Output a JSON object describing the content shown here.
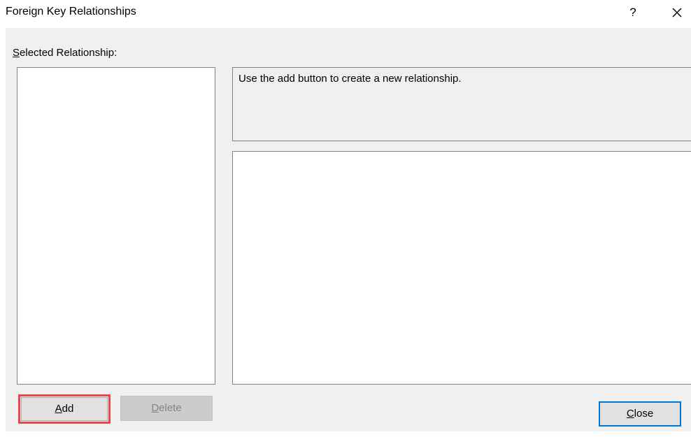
{
  "window": {
    "title": "Foreign Key Relationships",
    "help_glyph": "?",
    "close_icon": "close-icon"
  },
  "left_panel": {
    "label_mnemonic": "S",
    "label_rest": "elected Relationship:",
    "relationships": []
  },
  "right_panel": {
    "description": "Use the add button to create a new relationship."
  },
  "buttons": {
    "add_mnemonic": "A",
    "add_rest": "dd",
    "delete_mnemonic": "D",
    "delete_rest": "elete",
    "close_mnemonic": "C",
    "close_rest": "lose"
  },
  "colors": {
    "highlight": "#e8474e",
    "default_button_border": "#0078d7"
  }
}
